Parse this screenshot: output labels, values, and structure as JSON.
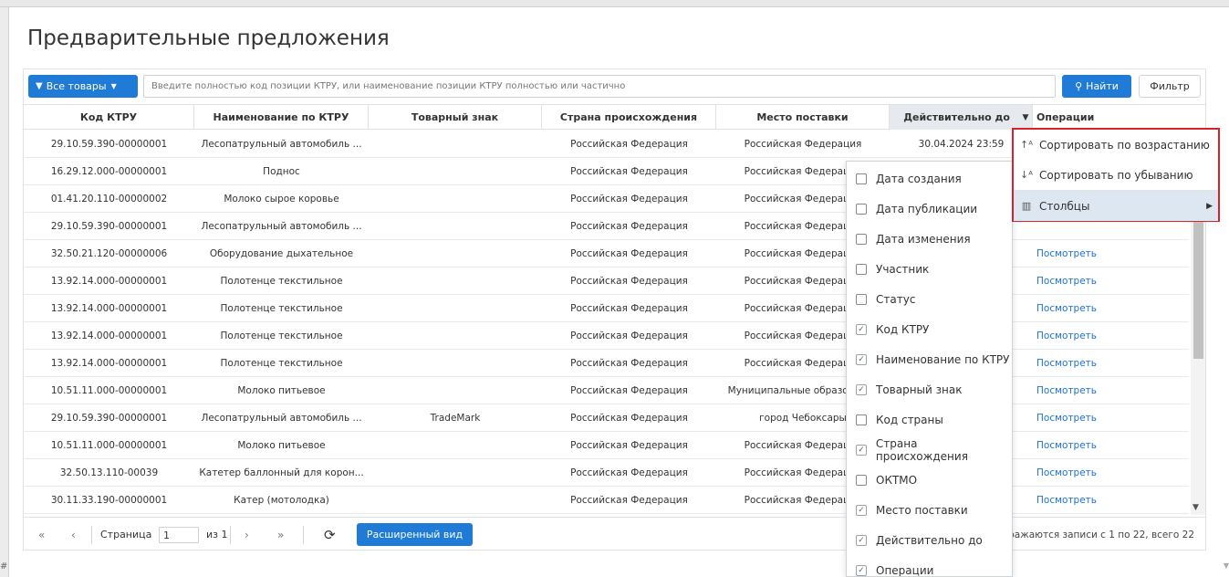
{
  "page": {
    "title": "Предварительные предложения"
  },
  "toolbar": {
    "all_goods_label": "Все товары",
    "search_placeholder": "Введите полностью код позиции КТРУ, или наименование позиции КТРУ полностью или частично",
    "find_label": "Найти",
    "filter_label": "Фильтр"
  },
  "table": {
    "columns": [
      "Код КТРУ",
      "Наименование по КТРУ",
      "Товарный знак",
      "Страна происхождения",
      "Место поставки",
      "Действительно до",
      "Операции"
    ],
    "rows": [
      {
        "code": "29.10.59.390-00000001",
        "name": "Лесопатрульный автомобиль ...",
        "brand": "",
        "country": "Российская Федерация",
        "place": "Российская Федерация",
        "valid": "30.04.2024 23:59",
        "op": ""
      },
      {
        "code": "16.29.12.000-00000001",
        "name": "Поднос",
        "brand": "",
        "country": "Российская Федерация",
        "place": "Российская Федерация",
        "valid": "",
        "op": ""
      },
      {
        "code": "01.41.20.110-00000002",
        "name": "Молоко сырое коровье",
        "brand": "",
        "country": "Российская Федерация",
        "place": "Российская Федерация",
        "valid": "",
        "op": ""
      },
      {
        "code": "29.10.59.390-00000001",
        "name": "Лесопатрульный автомобиль ...",
        "brand": "",
        "country": "Российская Федерация",
        "place": "Российская Федерация",
        "valid": "",
        "op": ""
      },
      {
        "code": "32.50.21.120-00000006",
        "name": "Оборудование дыхательное",
        "brand": "",
        "country": "Российская Федерация",
        "place": "Российская Федерация",
        "valid": "",
        "op": "Посмотреть"
      },
      {
        "code": "13.92.14.000-00000001",
        "name": "Полотенце текстильное",
        "brand": "",
        "country": "Российская Федерация",
        "place": "Российская Федерация",
        "valid": "",
        "op": "Посмотреть"
      },
      {
        "code": "13.92.14.000-00000001",
        "name": "Полотенце текстильное",
        "brand": "",
        "country": "Российская Федерация",
        "place": "Российская Федерация",
        "valid": "",
        "op": "Посмотреть"
      },
      {
        "code": "13.92.14.000-00000001",
        "name": "Полотенце текстильное",
        "brand": "",
        "country": "Российская Федерация",
        "place": "Российская Федерация",
        "valid": "",
        "op": "Посмотреть"
      },
      {
        "code": "13.92.14.000-00000001",
        "name": "Полотенце текстильное",
        "brand": "",
        "country": "Российская Федерация",
        "place": "Российская Федерация",
        "valid": "",
        "op": "Посмотреть"
      },
      {
        "code": "10.51.11.000-00000001",
        "name": "Молоко питьевое",
        "brand": "",
        "country": "Российская Федерация",
        "place": "Муниципальные образования",
        "valid": "",
        "op": "Посмотреть"
      },
      {
        "code": "29.10.59.390-00000001",
        "name": "Лесопатрульный автомобиль ...",
        "brand": "TradeMark",
        "country": "Российская Федерация",
        "place": "город Чебоксары",
        "valid": "",
        "op": "Посмотреть"
      },
      {
        "code": "10.51.11.000-00000001",
        "name": "Молоко питьевое",
        "brand": "",
        "country": "Российская Федерация",
        "place": "Российская Федерация",
        "valid": "",
        "op": "Посмотреть"
      },
      {
        "code": "32.50.13.110-00039",
        "name": "Катетер баллонный для корон...",
        "brand": "",
        "country": "Российская Федерация",
        "place": "Российская Федерация",
        "valid": "",
        "op": "Посмотреть"
      },
      {
        "code": "30.11.33.190-00000001",
        "name": "Катер (мотолодка)",
        "brand": "",
        "country": "Российская Федерация",
        "place": "Российская Федерация",
        "valid": "",
        "op": "Посмотреть"
      }
    ]
  },
  "pager": {
    "first": "«",
    "prev": "‹",
    "page_label": "Страница",
    "page_value": "1",
    "of_label": "из 1",
    "next": "›",
    "last": "»",
    "refresh": "⟳",
    "extended_view_label": "Расширенный вид",
    "records_text": "бражаются записи с 1 по 22, всего 22"
  },
  "columns_menu": [
    {
      "label": "Дата создания",
      "checked": false
    },
    {
      "label": "Дата публикации",
      "checked": false
    },
    {
      "label": "Дата изменения",
      "checked": false
    },
    {
      "label": "Участник",
      "checked": false
    },
    {
      "label": "Статус",
      "checked": false
    },
    {
      "label": "Код КТРУ",
      "checked": true
    },
    {
      "label": "Наименование по КТРУ",
      "checked": true
    },
    {
      "label": "Товарный знак",
      "checked": true
    },
    {
      "label": "Код страны",
      "checked": false
    },
    {
      "label": "Страна происхождения",
      "checked": true
    },
    {
      "label": "ОКТМО",
      "checked": false
    },
    {
      "label": "Место поставки",
      "checked": true
    },
    {
      "label": "Действительно до",
      "checked": true
    },
    {
      "label": "Операции",
      "checked": true
    }
  ],
  "context_menu": {
    "sort_asc": "Сортировать по возрастанию",
    "sort_desc": "Сортировать по убыванию",
    "columns": "Столбцы"
  },
  "colors": {
    "primary": "#1f7bd6",
    "highlight_border": "#d8222a",
    "link": "#1a73d9"
  }
}
